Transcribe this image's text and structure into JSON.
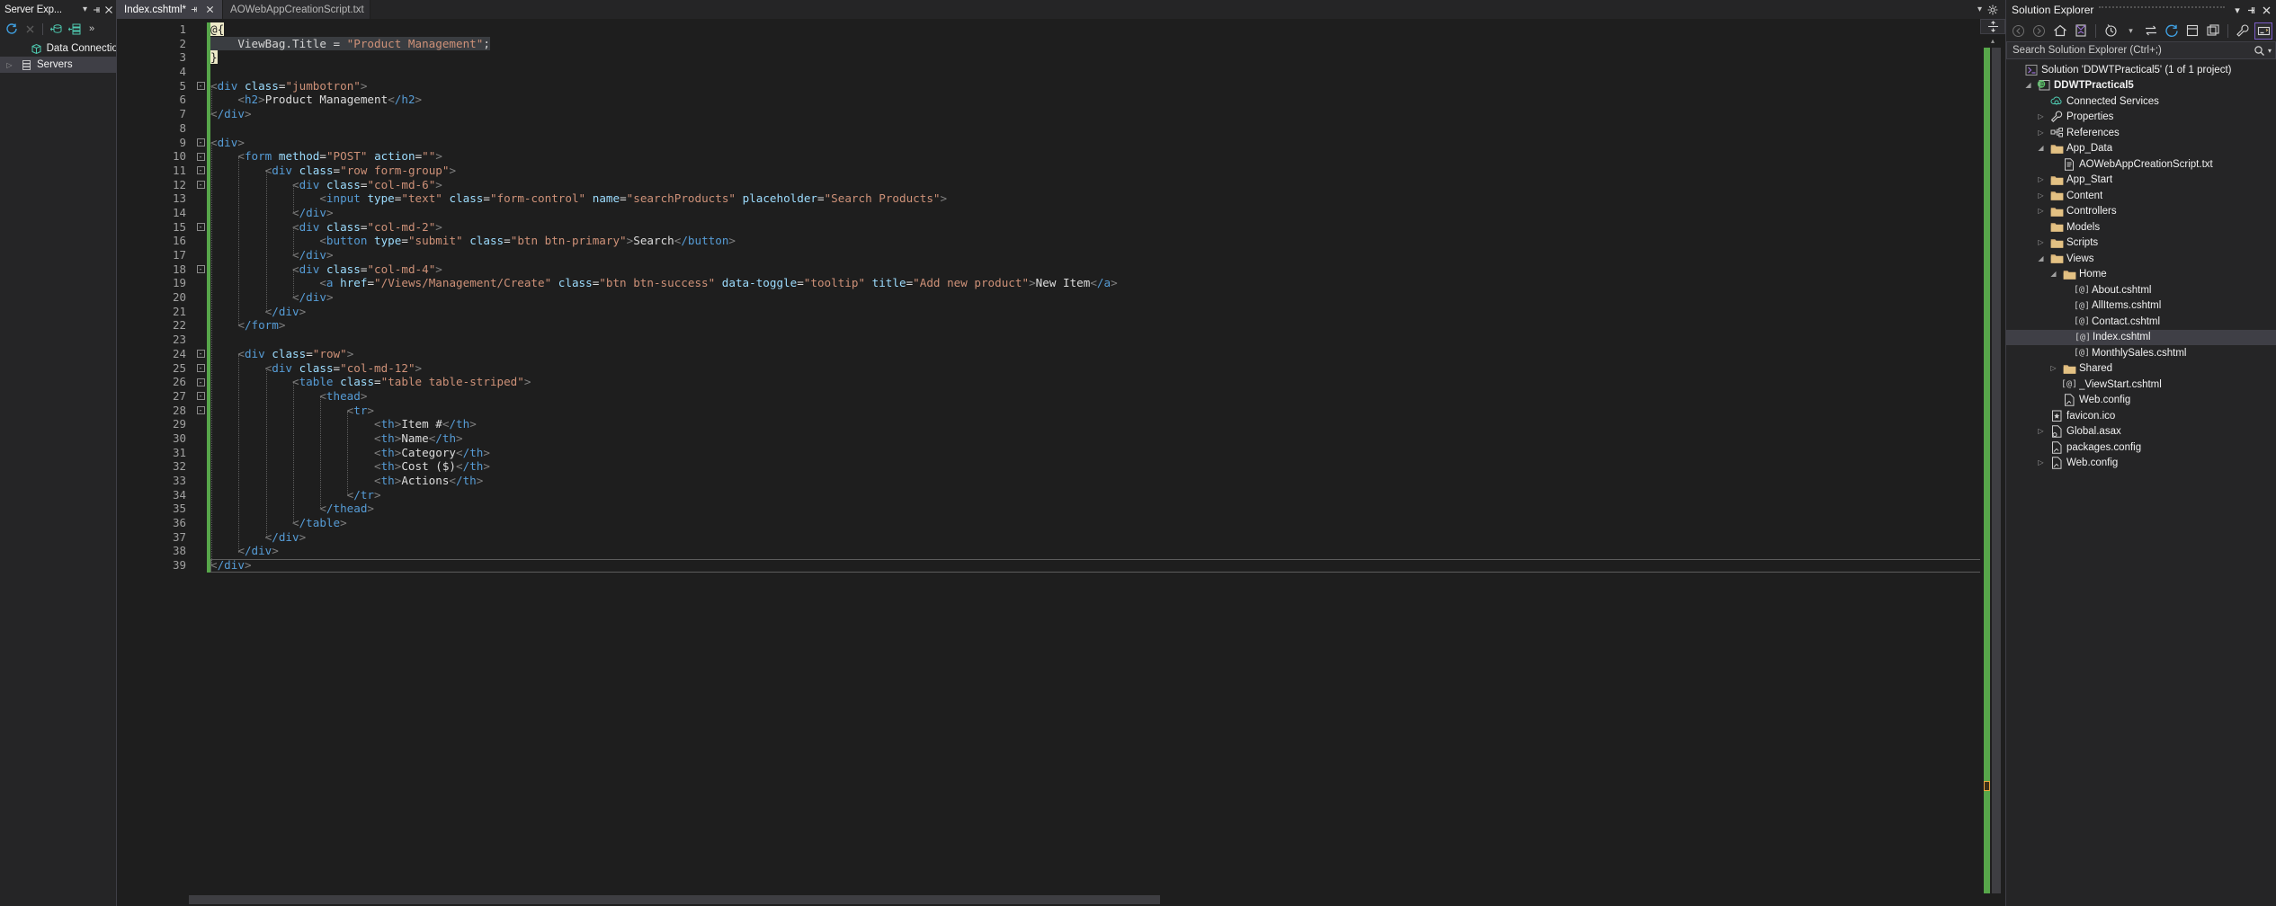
{
  "server_explorer": {
    "title": "Server Exp...",
    "header_buttons": [
      {
        "name": "dropdown-icon",
        "glyph": "▾"
      },
      {
        "name": "pin-icon",
        "glyph": "⇥"
      },
      {
        "name": "close-icon",
        "glyph": "✕"
      }
    ],
    "toolbar": [
      {
        "name": "refresh-icon",
        "glyph": "↻"
      },
      {
        "name": "stop-icon",
        "glyph": "✕"
      },
      {
        "name": "connect-to-database-icon",
        "glyph": "db"
      },
      {
        "name": "connect-to-server-icon",
        "glyph": "srv"
      },
      {
        "name": "overflow-icon",
        "glyph": "»"
      }
    ],
    "tree": [
      {
        "label": "Data Connections",
        "icon": "database-icon",
        "twisty": "",
        "selected": false,
        "indent": 1
      },
      {
        "label": "Servers",
        "icon": "servers-icon",
        "twisty": "▷",
        "selected": true,
        "indent": 0
      }
    ]
  },
  "tabs": [
    {
      "label": "Index.cshtml*",
      "active": true,
      "pin": "⇥",
      "close": "✕"
    },
    {
      "label": "AOWebAppCreationScript.txt",
      "active": false,
      "pin": "",
      "close": ""
    }
  ],
  "tabstrip_right": [
    {
      "name": "tab-overflow-icon",
      "glyph": "▾"
    },
    {
      "name": "editor-settings-icon",
      "glyph": "⚙"
    }
  ],
  "editor": {
    "split_button": "⇹",
    "scroll_up_arrow": "▴",
    "cursor_line": 39,
    "cursor_column": 1,
    "first_line": 1,
    "last_line": 39,
    "lines": [
      {
        "n": 1,
        "text": "@{",
        "fold": "",
        "change": true
      },
      {
        "n": 2,
        "text": "    ViewBag.Title = \"Product Management\";",
        "fold": "",
        "change": true
      },
      {
        "n": 3,
        "text": "}",
        "fold": "",
        "change": true
      },
      {
        "n": 4,
        "text": "",
        "fold": "",
        "change": true
      },
      {
        "n": 5,
        "text": "<div class=\"jumbotron\">",
        "fold": "-",
        "change": true
      },
      {
        "n": 6,
        "text": "    <h2>Product Management</h2>",
        "fold": "",
        "change": true
      },
      {
        "n": 7,
        "text": "</div>",
        "fold": "",
        "change": true
      },
      {
        "n": 8,
        "text": "",
        "fold": "",
        "change": true
      },
      {
        "n": 9,
        "text": "<div>",
        "fold": "-",
        "change": true
      },
      {
        "n": 10,
        "text": "    <form method=\"POST\" action=\"\">",
        "fold": "-",
        "change": true
      },
      {
        "n": 11,
        "text": "        <div class=\"row form-group\">",
        "fold": "-",
        "change": true
      },
      {
        "n": 12,
        "text": "            <div class=\"col-md-6\">",
        "fold": "-",
        "change": true
      },
      {
        "n": 13,
        "text": "                <input type=\"text\" class=\"form-control\" name=\"searchProducts\" placeholder=\"Search Products\">",
        "fold": "",
        "change": true
      },
      {
        "n": 14,
        "text": "            </div>",
        "fold": "",
        "change": true
      },
      {
        "n": 15,
        "text": "            <div class=\"col-md-2\">",
        "fold": "-",
        "change": true
      },
      {
        "n": 16,
        "text": "                <button type=\"submit\" class=\"btn btn-primary\">Search</button>",
        "fold": "",
        "change": true
      },
      {
        "n": 17,
        "text": "            </div>",
        "fold": "",
        "change": true
      },
      {
        "n": 18,
        "text": "            <div class=\"col-md-4\">",
        "fold": "-",
        "change": true
      },
      {
        "n": 19,
        "text": "                <a href=\"/Views/Management/Create\" class=\"btn btn-success\" data-toggle=\"tooltip\" title=\"Add new product\">New Item</a>",
        "fold": "",
        "change": true
      },
      {
        "n": 20,
        "text": "            </div>",
        "fold": "",
        "change": true
      },
      {
        "n": 21,
        "text": "        </div>",
        "fold": "",
        "change": true
      },
      {
        "n": 22,
        "text": "    </form>",
        "fold": "",
        "change": true
      },
      {
        "n": 23,
        "text": "",
        "fold": "",
        "change": true
      },
      {
        "n": 24,
        "text": "    <div class=\"row\">",
        "fold": "-",
        "change": true
      },
      {
        "n": 25,
        "text": "        <div class=\"col-md-12\">",
        "fold": "-",
        "change": true
      },
      {
        "n": 26,
        "text": "            <table class=\"table table-striped\">",
        "fold": "-",
        "change": true
      },
      {
        "n": 27,
        "text": "                <thead>",
        "fold": "-",
        "change": true
      },
      {
        "n": 28,
        "text": "                    <tr>",
        "fold": "-",
        "change": true
      },
      {
        "n": 29,
        "text": "                        <th>Item #</th>",
        "fold": "",
        "change": true
      },
      {
        "n": 30,
        "text": "                        <th>Name</th>",
        "fold": "",
        "change": true
      },
      {
        "n": 31,
        "text": "                        <th>Category</th>",
        "fold": "",
        "change": true
      },
      {
        "n": 32,
        "text": "                        <th>Cost ($)</th>",
        "fold": "",
        "change": true
      },
      {
        "n": 33,
        "text": "                        <th>Actions</th>",
        "fold": "",
        "change": true
      },
      {
        "n": 34,
        "text": "                    </tr>",
        "fold": "",
        "change": true
      },
      {
        "n": 35,
        "text": "                </thead>",
        "fold": "",
        "change": true
      },
      {
        "n": 36,
        "text": "            </table>",
        "fold": "",
        "change": true
      },
      {
        "n": 37,
        "text": "        </div>",
        "fold": "",
        "change": true
      },
      {
        "n": 38,
        "text": "    </div>",
        "fold": "",
        "change": true
      },
      {
        "n": 39,
        "text": "</div>",
        "fold": "",
        "change": true
      }
    ]
  },
  "solution_explorer": {
    "title": "Solution Explorer",
    "header_buttons": [
      {
        "name": "dropdown-icon",
        "glyph": "▾"
      },
      {
        "name": "pin-icon",
        "glyph": "⇥"
      },
      {
        "name": "close-icon",
        "glyph": "✕"
      }
    ],
    "toolbar": [
      {
        "name": "back-icon",
        "glyph": "←"
      },
      {
        "name": "forward-icon",
        "glyph": "→"
      },
      {
        "name": "home-icon",
        "glyph": "⌂"
      },
      {
        "name": "solution-navigator-icon",
        "glyph": "▣"
      },
      {
        "name": "pending-changes-filter-icon",
        "glyph": "◷"
      },
      {
        "name": "filter-dropdown-icon",
        "glyph": "▾"
      },
      {
        "name": "sync-with-active-document-icon",
        "glyph": "⇆"
      },
      {
        "name": "refresh-icon",
        "glyph": "↻"
      },
      {
        "name": "collapse-all-icon",
        "glyph": "⊟"
      },
      {
        "name": "show-all-files-icon",
        "glyph": "❐"
      },
      {
        "name": "properties-icon",
        "glyph": "🔧"
      },
      {
        "name": "preview-selected-items-icon",
        "glyph": "▤"
      }
    ],
    "search": {
      "placeholder": "Search Solution Explorer (Ctrl+;)",
      "value": "",
      "icon": "search-icon",
      "dropdown": "▾"
    },
    "tree": [
      {
        "label": "Solution 'DDWTPractical5' (1 of 1 project)",
        "icon": "solution-icon",
        "twisty": "",
        "indent": 0,
        "selected": false,
        "bold": false
      },
      {
        "label": "DDWTPractical5",
        "icon": "project-web-icon",
        "twisty": "◢",
        "indent": 1,
        "selected": false,
        "bold": true
      },
      {
        "label": "Connected Services",
        "icon": "connected-services-icon",
        "twisty": "",
        "indent": 2,
        "selected": false,
        "bold": false
      },
      {
        "label": "Properties",
        "icon": "properties-wrench-icon",
        "twisty": "▷",
        "indent": 2,
        "selected": false,
        "bold": false
      },
      {
        "label": "References",
        "icon": "references-icon",
        "twisty": "▷",
        "indent": 2,
        "selected": false,
        "bold": false
      },
      {
        "label": "App_Data",
        "icon": "folder-icon",
        "twisty": "◢",
        "indent": 2,
        "selected": false,
        "bold": false
      },
      {
        "label": "AOWebAppCreationScript.txt",
        "icon": "text-file-icon",
        "twisty": "",
        "indent": 3,
        "selected": false,
        "bold": false
      },
      {
        "label": "App_Start",
        "icon": "folder-icon",
        "twisty": "▷",
        "indent": 2,
        "selected": false,
        "bold": false
      },
      {
        "label": "Content",
        "icon": "folder-icon",
        "twisty": "▷",
        "indent": 2,
        "selected": false,
        "bold": false
      },
      {
        "label": "Controllers",
        "icon": "folder-icon",
        "twisty": "▷",
        "indent": 2,
        "selected": false,
        "bold": false
      },
      {
        "label": "Models",
        "icon": "folder-icon",
        "twisty": "",
        "indent": 2,
        "selected": false,
        "bold": false
      },
      {
        "label": "Scripts",
        "icon": "folder-icon",
        "twisty": "▷",
        "indent": 2,
        "selected": false,
        "bold": false
      },
      {
        "label": "Views",
        "icon": "folder-icon",
        "twisty": "◢",
        "indent": 2,
        "selected": false,
        "bold": false
      },
      {
        "label": "Home",
        "icon": "folder-icon",
        "twisty": "◢",
        "indent": 3,
        "selected": false,
        "bold": false
      },
      {
        "label": "About.cshtml",
        "icon": "razor-file-icon",
        "twisty": "",
        "indent": 4,
        "selected": false,
        "bold": false
      },
      {
        "label": "AllItems.cshtml",
        "icon": "razor-file-icon",
        "twisty": "",
        "indent": 4,
        "selected": false,
        "bold": false
      },
      {
        "label": "Contact.cshtml",
        "icon": "razor-file-icon",
        "twisty": "",
        "indent": 4,
        "selected": false,
        "bold": false
      },
      {
        "label": "Index.cshtml",
        "icon": "razor-file-icon",
        "twisty": "",
        "indent": 4,
        "selected": true,
        "bold": false
      },
      {
        "label": "MonthlySales.cshtml",
        "icon": "razor-file-icon",
        "twisty": "",
        "indent": 4,
        "selected": false,
        "bold": false
      },
      {
        "label": "Shared",
        "icon": "folder-icon",
        "twisty": "▷",
        "indent": 3,
        "selected": false,
        "bold": false
      },
      {
        "label": "_ViewStart.cshtml",
        "icon": "razor-file-icon",
        "twisty": "",
        "indent": 3,
        "selected": false,
        "bold": false
      },
      {
        "label": "Web.config",
        "icon": "config-file-icon",
        "twisty": "",
        "indent": 3,
        "selected": false,
        "bold": false
      },
      {
        "label": "favicon.ico",
        "icon": "icon-file-icon",
        "twisty": "",
        "indent": 2,
        "selected": false,
        "bold": false
      },
      {
        "label": "Global.asax",
        "icon": "asax-file-icon",
        "twisty": "▷",
        "indent": 2,
        "selected": false,
        "bold": false
      },
      {
        "label": "packages.config",
        "icon": "config-file-icon",
        "twisty": "",
        "indent": 2,
        "selected": false,
        "bold": false
      },
      {
        "label": "Web.config",
        "icon": "config-file-icon",
        "twisty": "▷",
        "indent": 2,
        "selected": false,
        "bold": false
      }
    ]
  },
  "colors": {
    "background": "#1e1e1e",
    "panel": "#252526",
    "selection": "#3f3f46",
    "tag": "#569cd6",
    "attribute": "#9cdcfe",
    "string": "#ce9178",
    "razor_highlight": "#ede9c8",
    "change_bar": "#57a64a",
    "caret": "#e8a33d",
    "folder": "#dcb67a",
    "accent_purple": "#7a5cc6"
  }
}
